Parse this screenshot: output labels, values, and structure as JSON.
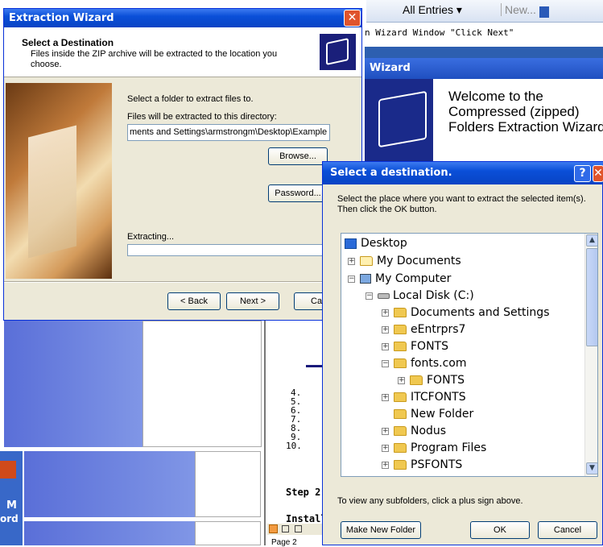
{
  "bg": {
    "toolbar": {
      "all_entries": "All Entries ▾",
      "new": "New..."
    },
    "banner_text": "n Wizard Window \"Click Next\"",
    "wizard2_title": "Wizard",
    "welcome_text": "Welcome to the Compressed (zipped) Folders Extraction Wizard",
    "list_numbers": [
      "4.",
      "5.",
      "6.",
      "7.",
      "8.",
      "9.",
      "10."
    ],
    "step_text": "Step 2:",
    "install_text": "Installi",
    "page_text": "Page 2",
    "desktop_left": [
      "M",
      "ord"
    ]
  },
  "wizard": {
    "title": "Extraction Wizard",
    "heading": "Select a Destination",
    "subtext": "Files inside the ZIP archive will be extracted to the location you choose.",
    "select_label": "Select a folder to extract files to.",
    "dir_label": "Files will be extracted to this directory:",
    "path_value": "ments and Settings\\armstrongm\\Desktop\\Example",
    "browse": "Browse...",
    "password": "Password...",
    "extracting": "Extracting...",
    "back": "< Back",
    "next": "Next >",
    "cancel": "Ca"
  },
  "dialog": {
    "title": "Select a destination.",
    "help": "?",
    "instructions": "Select the place where you want to extract the selected item(s). Then click the OK button.",
    "tree": [
      {
        "label": "Desktop"
      },
      {
        "label": "My Documents"
      },
      {
        "label": "My Computer"
      },
      {
        "label": "Local Disk (C:)"
      },
      {
        "label": "Documents and Settings"
      },
      {
        "label": "eEntrprs7"
      },
      {
        "label": "FONTS"
      },
      {
        "label": "fonts.com"
      },
      {
        "label": "FONTS"
      },
      {
        "label": "ITCFONTS"
      },
      {
        "label": "New Folder"
      },
      {
        "label": "Nodus"
      },
      {
        "label": "Program Files"
      },
      {
        "label": "PSFONTS"
      }
    ],
    "hint": "To view any subfolders, click a plus sign above.",
    "make_new_folder": "Make New Folder",
    "ok": "OK",
    "cancel": "Cancel"
  }
}
